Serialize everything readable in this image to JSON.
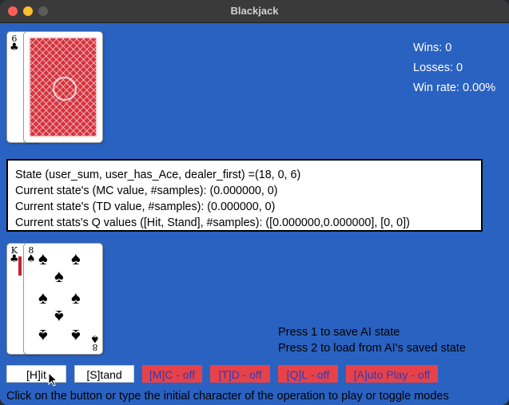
{
  "window": {
    "title": "Blackjack"
  },
  "dealer": {
    "hidden_card": {
      "rank": "6",
      "suit": "♣"
    }
  },
  "stats": {
    "wins": "Wins: 0",
    "losses": "Losses: 0",
    "win_rate": "Win rate: 0.00%"
  },
  "state_box": {
    "line1": "State (user_sum, user_has_Ace, dealer_first) =(18, 0, 6)",
    "line2": "Current state's (MC value, #samples): (0.000000, 0)",
    "line3": "Current state's (TD value, #samples): (0.000000, 0)",
    "line4": "Current stats's Q values ([Hit, Stand], #samples): ([0.000000,0.000000], [0, 0])"
  },
  "player": {
    "card1": {
      "rank": "K",
      "suit": "♣"
    },
    "card2": {
      "rank": "8",
      "suit": "♠"
    }
  },
  "hints": {
    "save": "Press 1 to save AI state",
    "load": "Press 2 to load from AI's saved state"
  },
  "buttons": {
    "hit": "[H]it",
    "stand": "[S]tand",
    "mc": "[M]C - off",
    "td": "[T]D - off",
    "ql": "[Q]L - off",
    "auto": "[A]uto Play - off"
  },
  "footer": "Click on the button or type the initial character of the operation to play or toggle modes",
  "colors": {
    "background": "#2a62c1",
    "mode_button": "#e74249",
    "mode_text": "#2d3bb5"
  }
}
